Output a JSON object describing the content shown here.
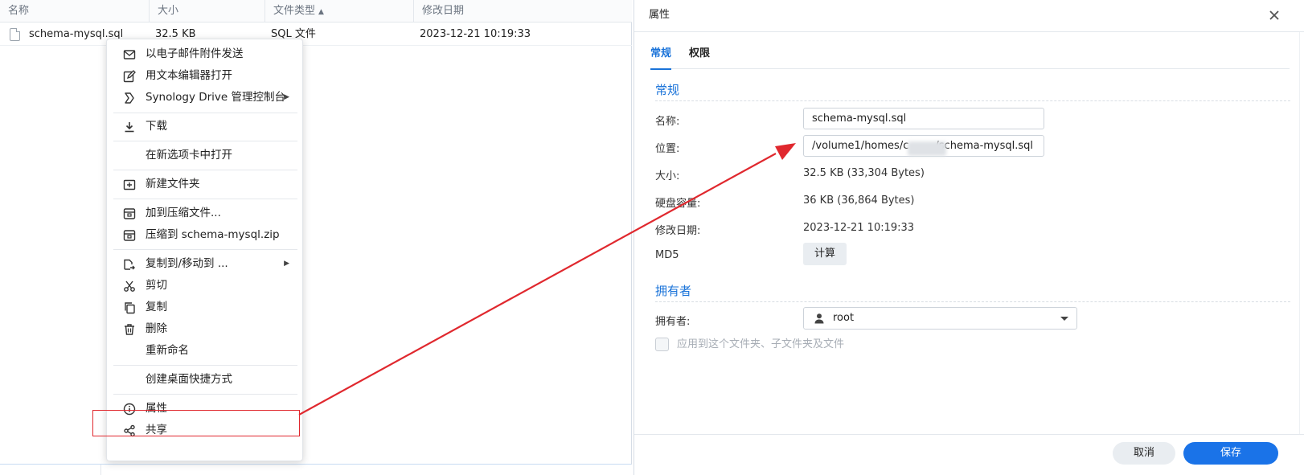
{
  "file_list": {
    "columns": [
      "名称",
      "大小",
      "文件类型",
      "修改日期"
    ],
    "row": {
      "name": "schema-mysql.sql",
      "size": "32.5 KB",
      "type": "SQL 文件",
      "date": "2023-12-21 10:19:33"
    }
  },
  "context_menu": {
    "items": [
      {
        "label": "以电子邮件附件发送",
        "icon": "mail-icon"
      },
      {
        "label": "用文本编辑器打开",
        "icon": "edit-icon"
      },
      {
        "label": "Synology Drive 管理控制台",
        "icon": "synology-drive-icon",
        "submenu": true
      },
      {
        "label": "下载",
        "icon": "download-icon"
      },
      {
        "label": "在新选项卡中打开",
        "icon": ""
      },
      {
        "label": "新建文件夹",
        "icon": "new-folder-icon"
      },
      {
        "label": "加到压缩文件...",
        "icon": "archive-icon"
      },
      {
        "label": "压缩到 schema-mysql.zip",
        "icon": "archive-icon"
      },
      {
        "label": "复制到/移动到 ...",
        "icon": "copy-move-icon",
        "submenu": true
      },
      {
        "label": "剪切",
        "icon": "scissors-icon"
      },
      {
        "label": "复制",
        "icon": "copy-icon"
      },
      {
        "label": "删除",
        "icon": "trash-icon"
      },
      {
        "label": "重新命名",
        "icon": ""
      },
      {
        "label": "创建桌面快捷方式",
        "icon": ""
      },
      {
        "label": "属性",
        "icon": "info-icon"
      },
      {
        "label": "共享",
        "icon": "share-icon"
      }
    ]
  },
  "dialog": {
    "title": "属性",
    "tabs": [
      "常规",
      "权限"
    ],
    "general": {
      "section_title": "常规",
      "name_label": "名称:",
      "name_value": "schema-mysql.sql",
      "location_label": "位置:",
      "location_value": "/volume1/homes/c        /schema-mysql.sql",
      "size_label": "大小:",
      "size_value": "32.5 KB (33,304 Bytes)",
      "disk_label": "硬盘容量:",
      "disk_value": "36 KB (36,864 Bytes)",
      "modified_label": "修改日期:",
      "modified_value": "2023-12-21 10:19:33",
      "md5_label": "MD5",
      "md5_button": "计算"
    },
    "owner": {
      "section_title": "拥有者",
      "owner_label": "拥有者:",
      "owner_value": "root",
      "apply_label": "应用到这个文件夹、子文件夹及文件"
    },
    "buttons": {
      "cancel": "取消",
      "save": "保存"
    }
  },
  "colors": {
    "accent": "#1a73e8",
    "annotation_red": "#e0282e"
  }
}
